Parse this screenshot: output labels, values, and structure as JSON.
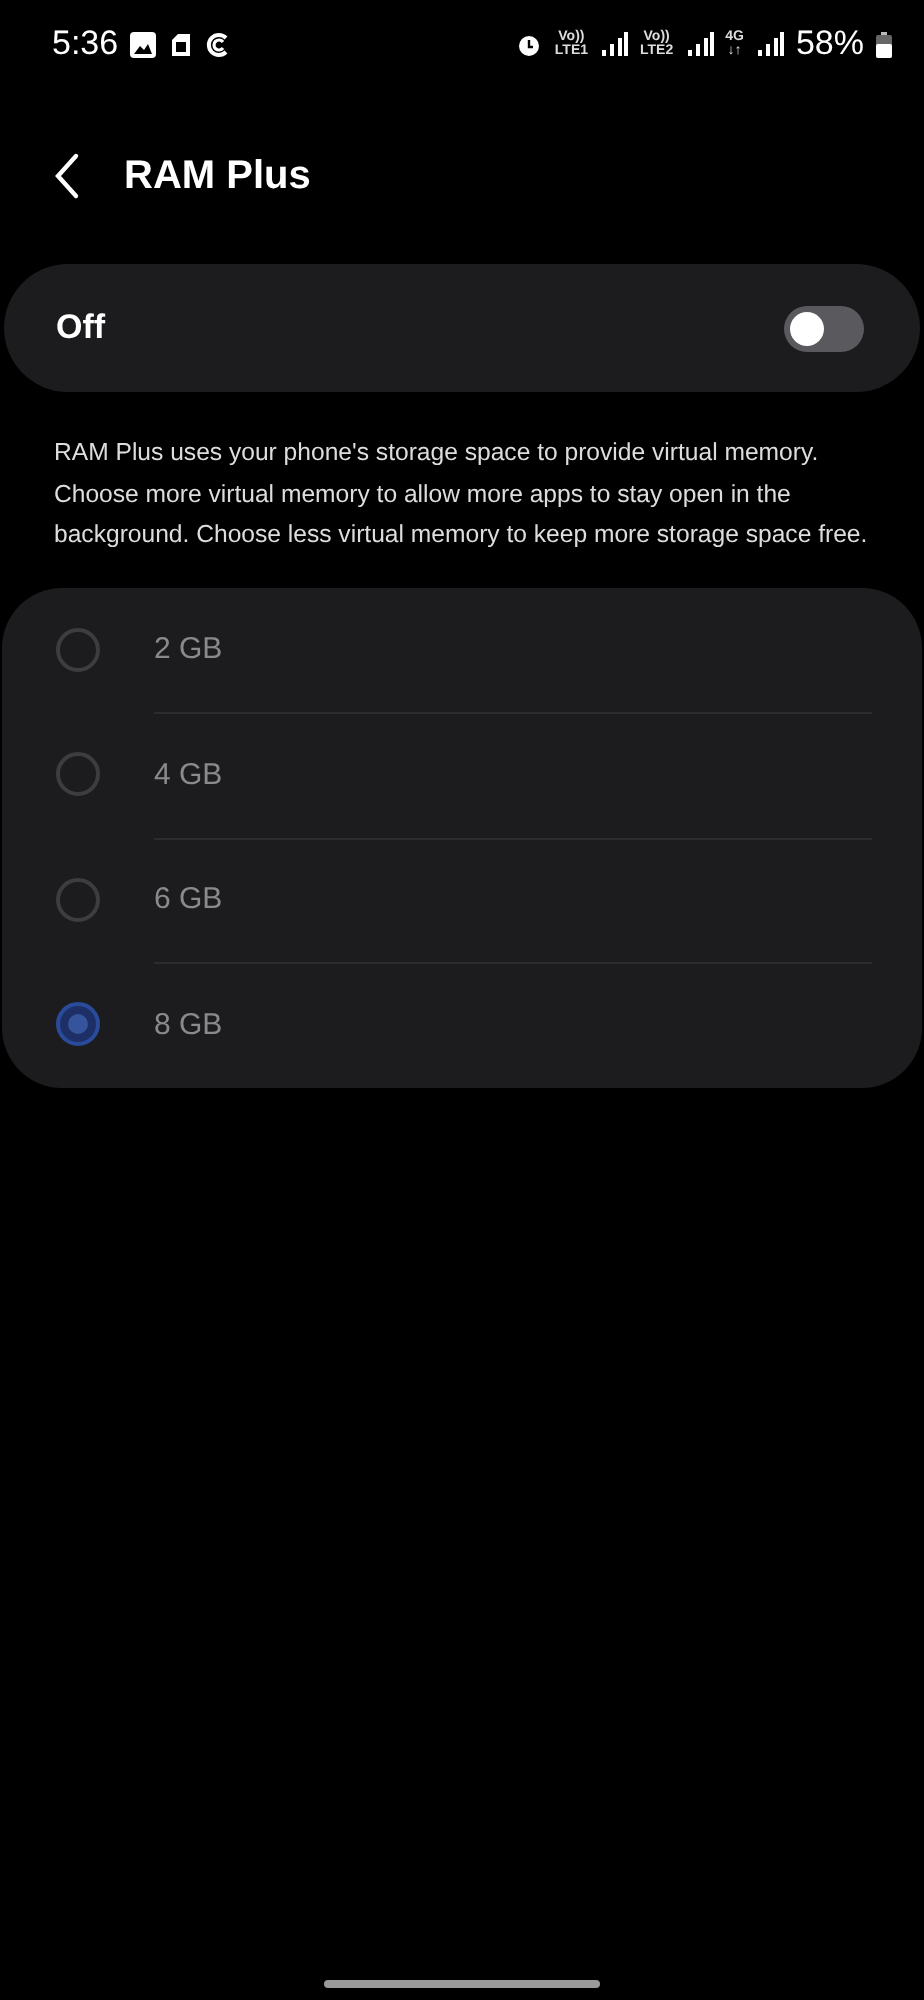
{
  "status_bar": {
    "time": "5:36",
    "network": [
      {
        "top": "Vo))",
        "bottom": "LTE1"
      },
      {
        "top": "Vo))",
        "bottom": "LTE2"
      },
      {
        "top": "4G",
        "bottom": "↓↑"
      }
    ],
    "battery": "58%"
  },
  "header": {
    "title": "RAM Plus"
  },
  "master_switch": {
    "label": "Off",
    "on": false
  },
  "description": "RAM Plus uses your phone's storage space to provide virtual memory. Choose more virtual memory to allow more apps to stay open in the background. Choose less virtual memory to keep more storage space free.",
  "options": [
    {
      "label": "2 GB",
      "selected": false
    },
    {
      "label": "4 GB",
      "selected": false
    },
    {
      "label": "6 GB",
      "selected": false
    },
    {
      "label": "8 GB",
      "selected": true
    }
  ]
}
